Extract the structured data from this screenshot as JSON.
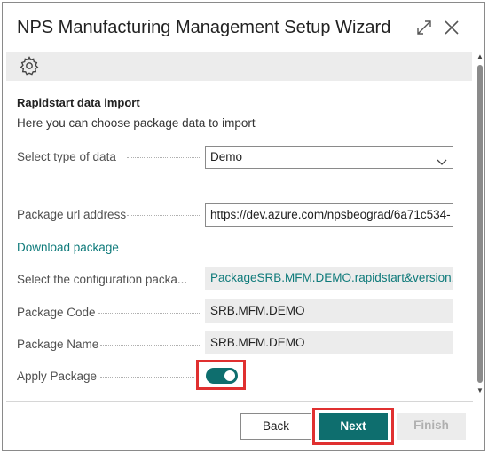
{
  "dialog": {
    "title": "NPS Manufacturing Management Setup Wizard",
    "icons": {
      "expand": "expand-icon",
      "close": "close-icon",
      "settings": "gear-icon"
    }
  },
  "section": {
    "title": "Rapidstart data import",
    "description": "Here you can choose package data to import"
  },
  "fields": {
    "data_type": {
      "label": "Select type of data",
      "value": "Demo"
    },
    "package_url": {
      "label": "Package url address",
      "value": "https://dev.azure.com/npsbeograd/6a71c534-"
    },
    "download_link": "Download package",
    "config_package": {
      "label": "Select the configuration packa...",
      "value": "PackageSRB.MFM.DEMO.rapidstart&version..."
    },
    "package_code": {
      "label": "Package Code",
      "value": "SRB.MFM.DEMO"
    },
    "package_name": {
      "label": "Package Name",
      "value": "SRB.MFM.DEMO"
    },
    "apply_package": {
      "label": "Apply Package",
      "value": true
    }
  },
  "buttons": {
    "back": "Back",
    "next": "Next",
    "finish": "Finish"
  },
  "colors": {
    "accent": "#0e6e6e",
    "link": "#0e7a7a",
    "highlight": "#e03030"
  }
}
